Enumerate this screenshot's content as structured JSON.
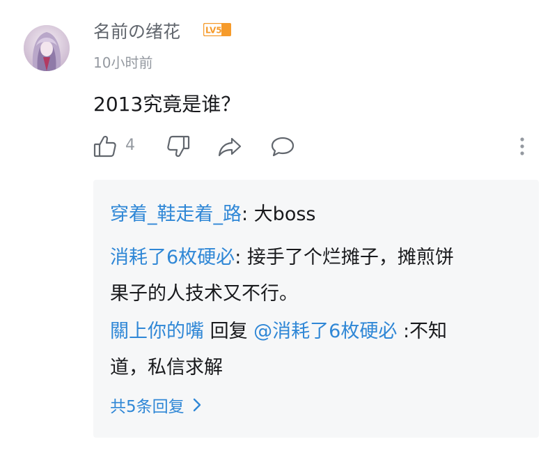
{
  "comment": {
    "username": "名前の绪花",
    "level_badge": "LV5",
    "timestamp": "10小时前",
    "text": "2013究竟是谁？",
    "like_count": "4"
  },
  "actions": {
    "like_icon": "thumbs-up-icon",
    "dislike_icon": "thumbs-down-icon",
    "share_icon": "share-icon",
    "reply_icon": "speech-bubble-icon",
    "more_icon": "vertical-dots-icon"
  },
  "replies": [
    {
      "author": "穿着_鞋走着_路",
      "text_lines": [
        ": 大boss"
      ]
    },
    {
      "author": "消耗了6枚硬必",
      "text_lines": [
        ": 接手了个烂摊子，摊煎饼",
        "果子的人技术又不行。"
      ]
    },
    {
      "author": "關上你的嘴",
      "reply_label": " 回复 ",
      "mention": "@消耗了6枚硬必",
      "text_lines": [
        " :不知",
        "道，私信求解"
      ]
    }
  ],
  "view_all": "共5条回复",
  "colors": {
    "link": "#2f87d6",
    "badge": "#f69b2b",
    "muted": "#9499a0",
    "reply_bg": "#f6f7f8"
  }
}
